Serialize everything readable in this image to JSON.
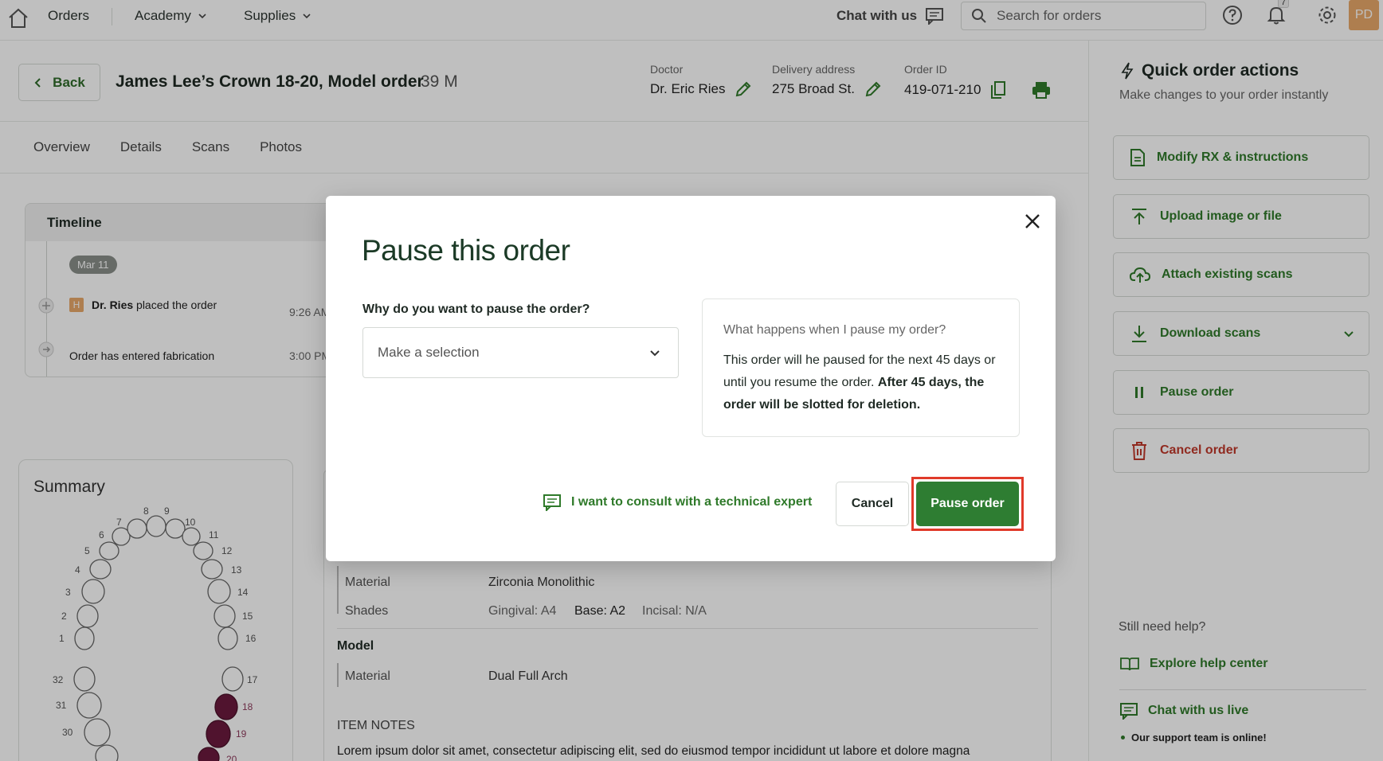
{
  "nav": {
    "items": [
      {
        "label": "Orders"
      },
      {
        "label": "Academy"
      },
      {
        "label": "Supplies"
      }
    ],
    "chat_label": "Chat with us",
    "search_placeholder": "Search for orders",
    "notification_count": "7",
    "avatar_initials": "PD"
  },
  "header": {
    "back_label": "Back",
    "title": "James Lee’s Crown 18-20, Model order",
    "weight": "39 M",
    "doctor_label": "Doctor",
    "doctor_value": "Dr. Eric Ries",
    "delivery_label": "Delivery address",
    "delivery_value": "275 Broad St.",
    "order_id_label": "Order ID",
    "order_id_value": "419-071-210"
  },
  "tabs": [
    "Overview",
    "Details",
    "Scans",
    "Photos"
  ],
  "timeline": {
    "title": "Timeline",
    "date": "Mar 11",
    "events": [
      {
        "badge": "H",
        "actor": "Dr. Ries",
        "text": "placed the order",
        "time": "9:26 AM"
      },
      {
        "text": "Order has entered fabrication",
        "time": "3:00 PM"
      }
    ]
  },
  "summary": {
    "title": "Summary",
    "tooth_numbers": [
      "1",
      "2",
      "3",
      "4",
      "5",
      "6",
      "7",
      "8",
      "9",
      "10",
      "11",
      "12",
      "13",
      "14",
      "15",
      "16",
      "17",
      "18",
      "19",
      "20",
      "30",
      "31",
      "32"
    ]
  },
  "details": {
    "material_label": "Material",
    "material_value": "Zirconia Monolithic",
    "shades_label": "Shades",
    "shade_gingival": "Gingival: A4",
    "shade_base": "Base: A2",
    "shade_incisal": "Incisal: N/A",
    "model_heading": "Model",
    "model_material_label": "Material",
    "model_material_value": "Dual Full Arch",
    "notes_heading": "ITEM NOTES",
    "notes_text": "Lorem ipsum dolor sit amet, consectetur adipiscing elit, sed do eiusmod tempor incididunt ut labore et dolore magna"
  },
  "sidebar": {
    "title": "Quick order actions",
    "subtitle": "Make changes to your order instantly",
    "actions": [
      {
        "label": "Modify RX & instructions"
      },
      {
        "label": "Upload image or file"
      },
      {
        "label": "Attach existing scans"
      },
      {
        "label": "Download scans"
      },
      {
        "label": "Pause order"
      },
      {
        "label": "Cancel order"
      }
    ],
    "help_title": "Still need help?",
    "help_center_label": "Explore help center",
    "chat_live_label": "Chat with us live",
    "online_text": "Our support team is online!"
  },
  "modal": {
    "title": "Pause this order",
    "question": "Why do you want to pause the order?",
    "select_placeholder": "Make a selection",
    "info_title": "What happens when I pause my order?",
    "info_text_1": "This order will he paused for the next 45 days or until you resume the order.",
    "info_text_bold": "After 45 days, the order will be slotted for deletion.",
    "consult_label": "I want to consult with a technical expert",
    "cancel_label": "Cancel",
    "confirm_label": "Pause order"
  },
  "colors": {
    "brand_green": "#2e7d32",
    "link_green": "#2f7a2a",
    "danger_red": "#c0392b",
    "highlight_red": "#e03a2a",
    "selected_tooth": "#6b1a3e"
  }
}
